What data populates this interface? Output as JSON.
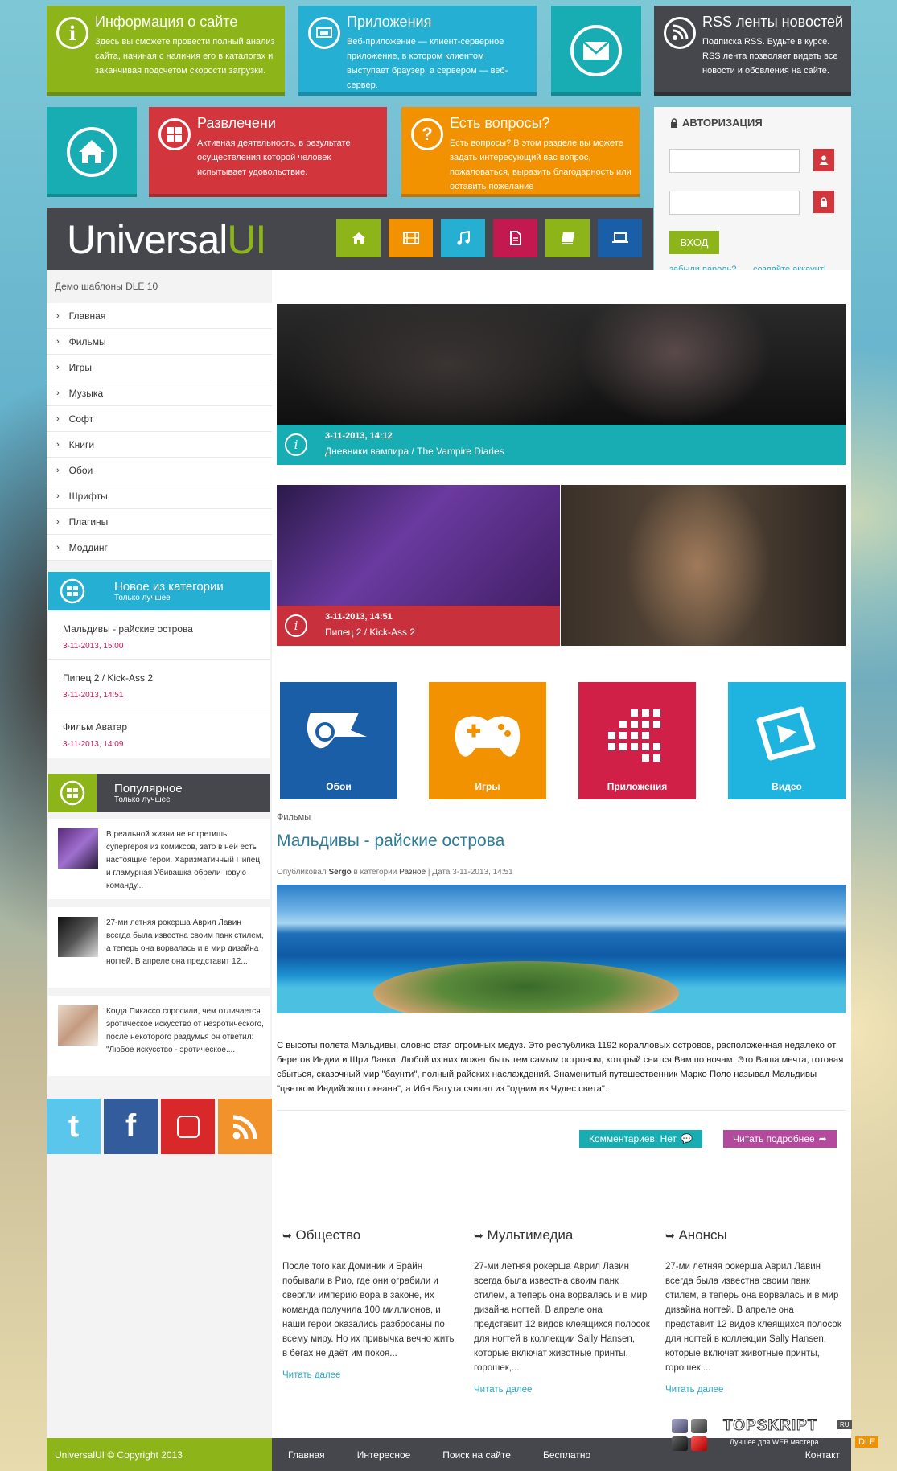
{
  "top_tiles": {
    "info": {
      "title": "Информация о сайте",
      "text": "Здесь вы сможете провести полный анализ сайта, начиная с наличия его в каталогах и заканчивая подсчетом скорости загрузки."
    },
    "apps": {
      "title": "Приложения",
      "text": "Веб-приложение — клиент-серверное приложение, в котором клиентом выступает браузер, а сервером — веб-сервер."
    },
    "rss": {
      "title": "RSS ленты новостей",
      "text": "Подписка RSS. Будьте в курсе. RSS лента позволяет видеть все новости и обовления на сайте."
    },
    "fun": {
      "title": "Развлечени",
      "text": "Активная деятельность, в результате осуществления которой человек испытывает удовольствие."
    },
    "faq": {
      "title": "Есть вопросы?",
      "text": "Есть вопросы? В этом разделе вы можете задать интересующий вас вопрос, пожаловаться, выразить благодарность или оставить пожелание"
    }
  },
  "logo": {
    "part1": "Universal",
    "part2": "UI"
  },
  "auth": {
    "title": "АВТОРИЗАЦИЯ",
    "login_btn": "ВХОД",
    "forgot": "забыли пароль?",
    "register": "создайте аккаунт!"
  },
  "site_subtitle": "Демо шаблоны DLE 10",
  "menu": [
    "Главная",
    "Фильмы",
    "Игры",
    "Музыка",
    "Софт",
    "Книги",
    "Обои",
    "Шрифты",
    "Плагины",
    "Моддинг"
  ],
  "new_block": {
    "title": "Новое из категории",
    "subtitle": "Только лучшее",
    "items": [
      {
        "title": "Мальдивы - райские острова",
        "date": "3-11-2013, 15:00"
      },
      {
        "title": "Пипец 2 / Kick-Ass 2",
        "date": "3-11-2013, 14:51"
      },
      {
        "title": "Фильм Аватар",
        "date": "3-11-2013, 14:09"
      }
    ]
  },
  "popular": {
    "title": "Популярное",
    "subtitle": "Только лучшее",
    "items": [
      "В реальной жизни не встретишь супергероя из комиксов, зато в ней есть настоящие герои. Харизматичный Пипец и гламурная Убивашка обрели новую команду...",
      "27-ми летняя рокерша Аврил Лавин всегда была известна своим панк стилем, а теперь она ворвалась и в мир дизайна ногтей. В апреле она представит 12...",
      "Когда Пикассо спросили, чем отличается эротическое искусство от неэротического, после некоторого раздумья он ответил: \"Любое искусство - эротическое...."
    ]
  },
  "slides": [
    {
      "date": "3-11-2013, 14:12",
      "title": "Дневники вампира / The Vampire Diaries"
    },
    {
      "date": "3-11-2013, 14:51",
      "title": "Пипец 2 / Kick-Ass 2"
    }
  ],
  "cats": [
    "Обои",
    "Игры",
    "Приложения",
    "Видео"
  ],
  "article": {
    "category": "Фильмы",
    "title": "Мальдивы - райские острова",
    "meta_prefix": "Опубликовал ",
    "author": "Sergo",
    "meta_mid": " в категории ",
    "meta_cat": "Разное",
    "meta_date": " | Дата 3-11-2013, 14:51",
    "body": "С высоты полета Мальдивы, словно стая огромных медуз. Это республика 1192 коралловых островов, расположенная недалеко от берегов Индии и Шри Ланки. Любой из них может быть тем самым островом, который снится Вам по ночам. Это Ваша мечта, готовая сбыться, сказочный мир \"баунти\", полный райских наслаждений. Знаменитый путешественник Марко Поло называл Мальдивы \"цветком Индийского океана\", а Ибн Батута считал из \"одним из Чудес света\".",
    "comments": "Комментариев: Нет",
    "more": "Читать подробнее"
  },
  "footer_cols": [
    {
      "title": "Общество",
      "text": "После того как Доминик и Брайн побывали в Рио, где они ограбили и свергли империю вора в законе, их команда получила 100 миллионов, и наши герои оказались разбросаны по всему миру. Но их привычка вечно жить в бегах не даёт им покоя...",
      "link": "Читать далее"
    },
    {
      "title": "Мультимедиа",
      "text": "27-ми летняя рокерша Аврил Лавин всегда была известна своим панк стилем, а теперь она ворвалась и в мир дизайна ногтей. В апреле она представит 12 видов клеящихся полосок для ногтей в коллекции Sally Hansen, которые включат животные принты, горошек,...",
      "link": "Читать далее"
    },
    {
      "title": "Анонсы",
      "text": "27-ми летняя рокерша Аврил Лавин всегда была известна своим панк стилем, а теперь она ворвалась и в мир дизайна ногтей. В апреле она представит 12 видов клеящихся полосок для ногтей в коллекции Sally Hansen, которые включат животные принты, горошек,...",
      "link": "Читать далее"
    }
  ],
  "footer": {
    "copyright": "UniversalUI © Copyright 2013",
    "nav": [
      "Главная",
      "Интересное",
      "Поиск на сайте",
      "Бесплатно",
      "Контакт"
    ]
  },
  "watermark": {
    "brand": "TOPSKRIPT",
    "tag": "Лучшее для WEB мастера",
    "ru": "RU",
    "dle": "DLE"
  },
  "colors": {
    "green": "#8db51a",
    "cyan": "#25afd2",
    "teal": "#18adb3",
    "red": "#d2353b",
    "orange": "#f39200",
    "dark": "#45474d",
    "blue": "#1b5ea8",
    "pink": "#c41850"
  }
}
